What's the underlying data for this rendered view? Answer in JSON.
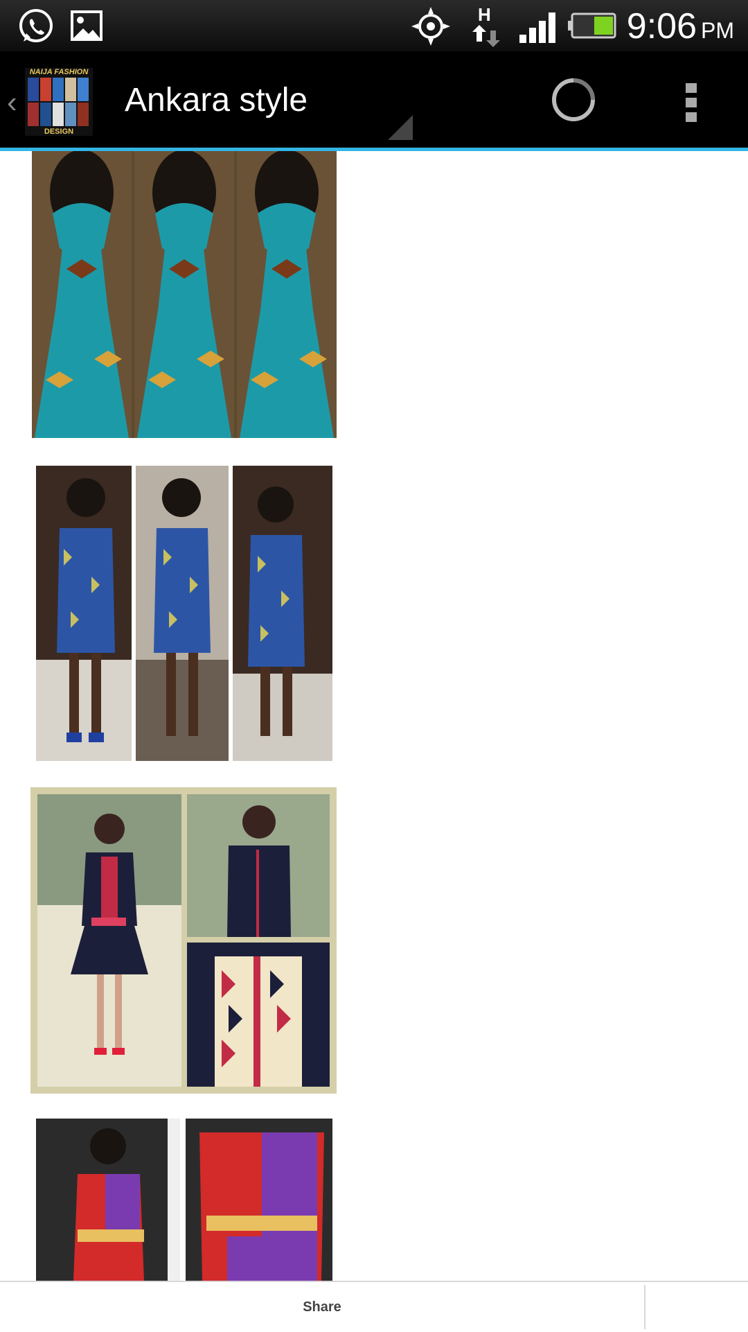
{
  "status_bar": {
    "time": "9:06",
    "ampm": "PM",
    "network_label": "H"
  },
  "action_bar": {
    "title": "Ankara style",
    "logo_text_top": "NAIJA FASHION",
    "logo_text_bottom": "DESIGN"
  },
  "gallery": {
    "items": [
      {
        "layout": "triptych",
        "colors": [
          "#1d9aa8",
          "#7a3a1a",
          "#d7a23a"
        ]
      },
      {
        "layout": "triptych",
        "colors": [
          "#2d55a6",
          "#c8c060",
          "#cfcac2"
        ]
      },
      {
        "layout": "collage",
        "colors": [
          "#1c1f3a",
          "#c22b45",
          "#f2e6c8"
        ]
      },
      {
        "layout": "pair",
        "colors": [
          "#d32a2a",
          "#7b3bb0",
          "#2b2b2b"
        ]
      }
    ]
  },
  "bottom_bar": {
    "share_label": "Share"
  },
  "colors": {
    "accent": "#33b5e5",
    "action_bar_bg": "#000000",
    "status_bar_bg": "#111111"
  }
}
